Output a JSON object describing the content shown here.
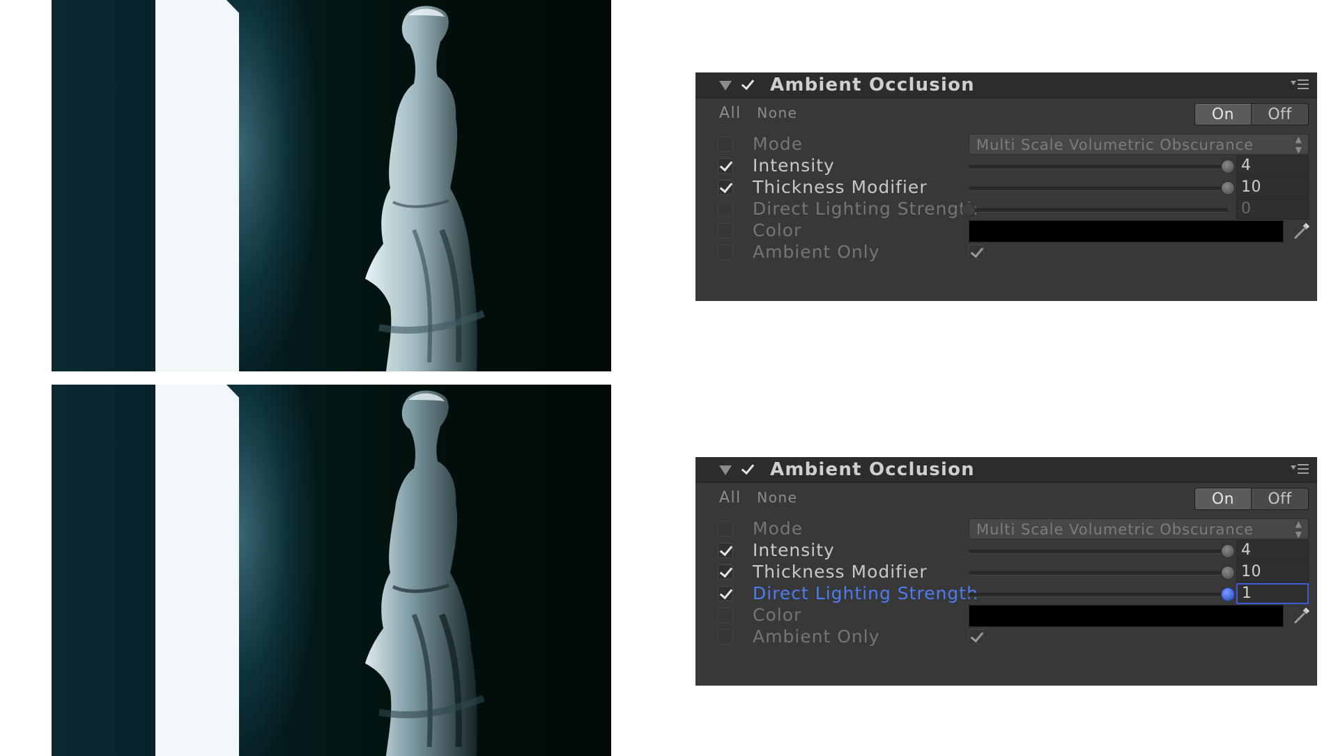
{
  "panels": [
    {
      "title": "Ambient Occlusion",
      "all_label": "All",
      "none_label": "None",
      "on_label": "On",
      "off_label": "Off",
      "rows": {
        "mode": {
          "label": "Mode",
          "value": "Multi Scale Volumetric Obscurance",
          "checked": false
        },
        "intensity": {
          "label": "Intensity",
          "value": "4",
          "checked": true,
          "slider_fraction": 1.0
        },
        "thickness": {
          "label": "Thickness Modifier",
          "value": "10",
          "checked": true,
          "slider_fraction": 1.0
        },
        "direct": {
          "label": "Direct Lighting Strength",
          "value": "0",
          "checked": false,
          "slider_fraction": 0.0
        },
        "color": {
          "label": "Color",
          "value": "#000000",
          "checked": false
        },
        "ambient_only": {
          "label": "Ambient Only",
          "checked": false,
          "value_checked": true
        }
      }
    },
    {
      "title": "Ambient Occlusion",
      "all_label": "All",
      "none_label": "None",
      "on_label": "On",
      "off_label": "Off",
      "rows": {
        "mode": {
          "label": "Mode",
          "value": "Multi Scale Volumetric Obscurance",
          "checked": false
        },
        "intensity": {
          "label": "Intensity",
          "value": "4",
          "checked": true,
          "slider_fraction": 1.0
        },
        "thickness": {
          "label": "Thickness Modifier",
          "value": "10",
          "checked": true,
          "slider_fraction": 1.0
        },
        "direct": {
          "label": "Direct Lighting Strength",
          "value": "1",
          "checked": true,
          "slider_fraction": 1.0
        },
        "color": {
          "label": "Color",
          "value": "#000000",
          "checked": false
        },
        "ambient_only": {
          "label": "Ambient Only",
          "checked": false,
          "value_checked": true
        }
      }
    }
  ],
  "colors": {
    "panel_bg": "#383838",
    "header_bg": "#2c2c2c",
    "active_blue": "#4c7cf2",
    "door_light": "#f2f7f9",
    "scene_dark": "#020d0c"
  }
}
